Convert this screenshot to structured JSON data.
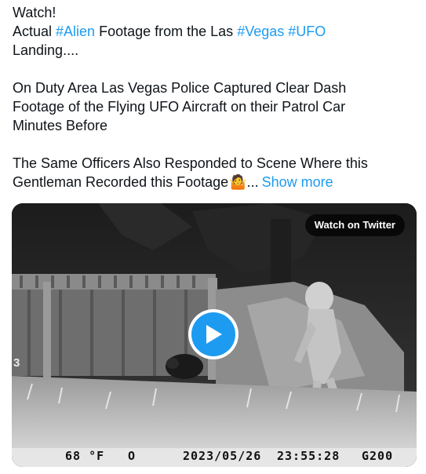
{
  "tweet": {
    "line1": "Watch!",
    "line2": {
      "t1": "Actual ",
      "tag1": "#Alien",
      "t2": " Footage from the Las ",
      "tag2": "#Vegas",
      "t3": " ",
      "tag3": "#UFO"
    },
    "line3": "Landing....",
    "line4": "On Duty Area Las Vegas Police Captured Clear Dash",
    "line5": "Footage of the Flying UFO Aircraft on their Patrol Car",
    "line6": "Minutes Before",
    "line7": "The Same Officers Also Responded to Scene Where this",
    "line8": {
      "text": "Gentleman Recorded this Footage",
      "emoji": "🤷",
      "ellipsis": "...",
      "show_more": "Show more"
    }
  },
  "media": {
    "watch_label": "Watch on Twitter",
    "play_icon": "play-icon",
    "left_mark": "3",
    "osd": {
      "temperature": "68 °F",
      "moon": "O",
      "date": "2023/05/26",
      "time": "23:55:28",
      "camera_id": "G200"
    }
  },
  "colors": {
    "link": "#1d9bf0",
    "text": "#0f1419",
    "play": "#1d9bf0"
  }
}
